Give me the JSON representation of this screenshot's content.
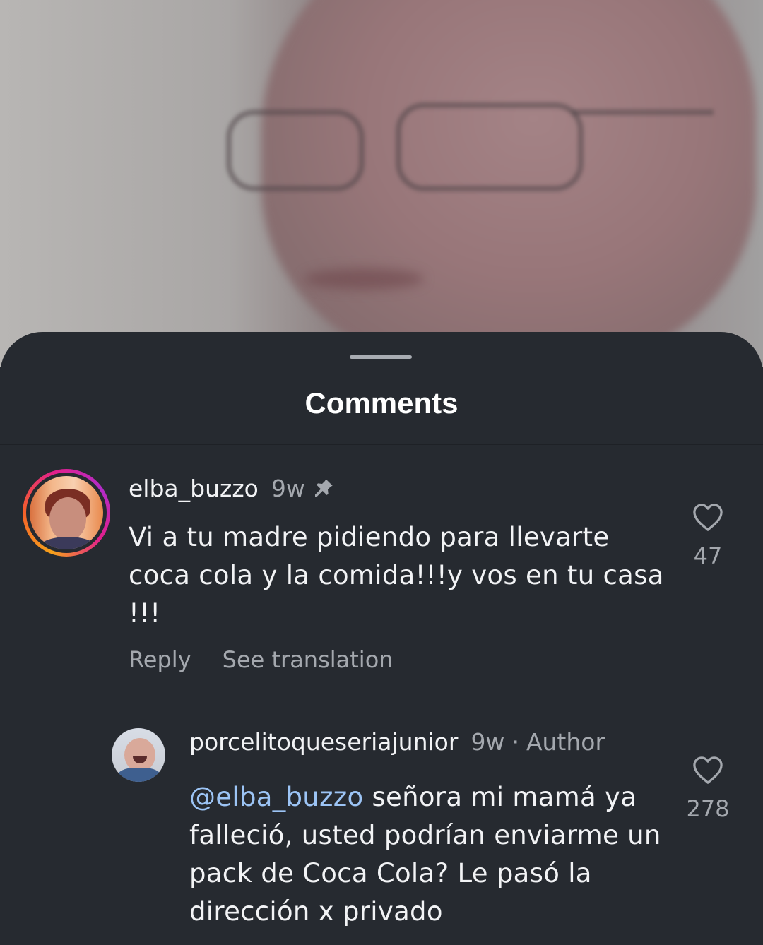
{
  "sheet": {
    "title": "Comments"
  },
  "comments": [
    {
      "username": "elba_buzzo",
      "time": "9w",
      "pinned": true,
      "text": "Vi a tu madre  pidiendo para llevarte coca cola  y la comida!!!y vos en tu casa !!!",
      "likes": "47",
      "reply_label": "Reply",
      "translate_label": "See translation",
      "avatar_ring": true
    },
    {
      "username": "porcelitoqueseriajunior",
      "time": "9w",
      "separator": "·",
      "author_label": "Author",
      "mention": "@elba_buzzo",
      "text": " señora mi mamá ya falleció, usted podrían enviarme un pack de Coca Cola? Le pasó la dirección x privado",
      "likes": "278"
    }
  ],
  "colors": {
    "sheet_bg": "#262a30",
    "text_primary": "#f2f3f5",
    "text_secondary": "#a4a8ae",
    "mention": "#9cc4f5",
    "story_ring_start": "#f7a21b",
    "story_ring_end": "#b22cc8"
  },
  "icons": {
    "pin": "pin-icon",
    "like": "heart-icon"
  }
}
